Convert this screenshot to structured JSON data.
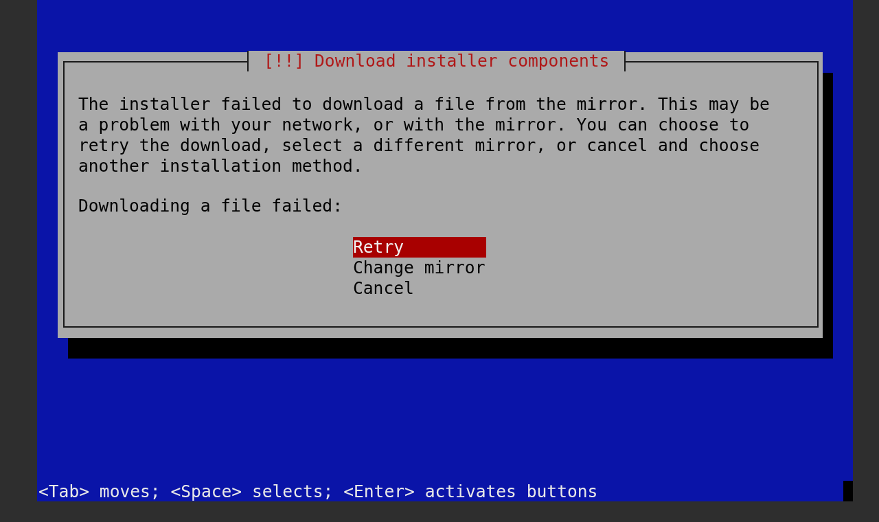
{
  "dialog": {
    "title": "[!!] Download installer components",
    "message": "The installer failed to download a file from the mirror. This may be a problem with your network, or with the mirror. You can choose to retry the download, select a different mirror, or cancel and choose another installation method.",
    "prompt": "Downloading a file failed:",
    "options": [
      {
        "label": "Retry",
        "selected": true
      },
      {
        "label": "Change mirror",
        "selected": false
      },
      {
        "label": "Cancel",
        "selected": false
      }
    ]
  },
  "help_line": "<Tab> moves; <Space> selects; <Enter> activates buttons"
}
